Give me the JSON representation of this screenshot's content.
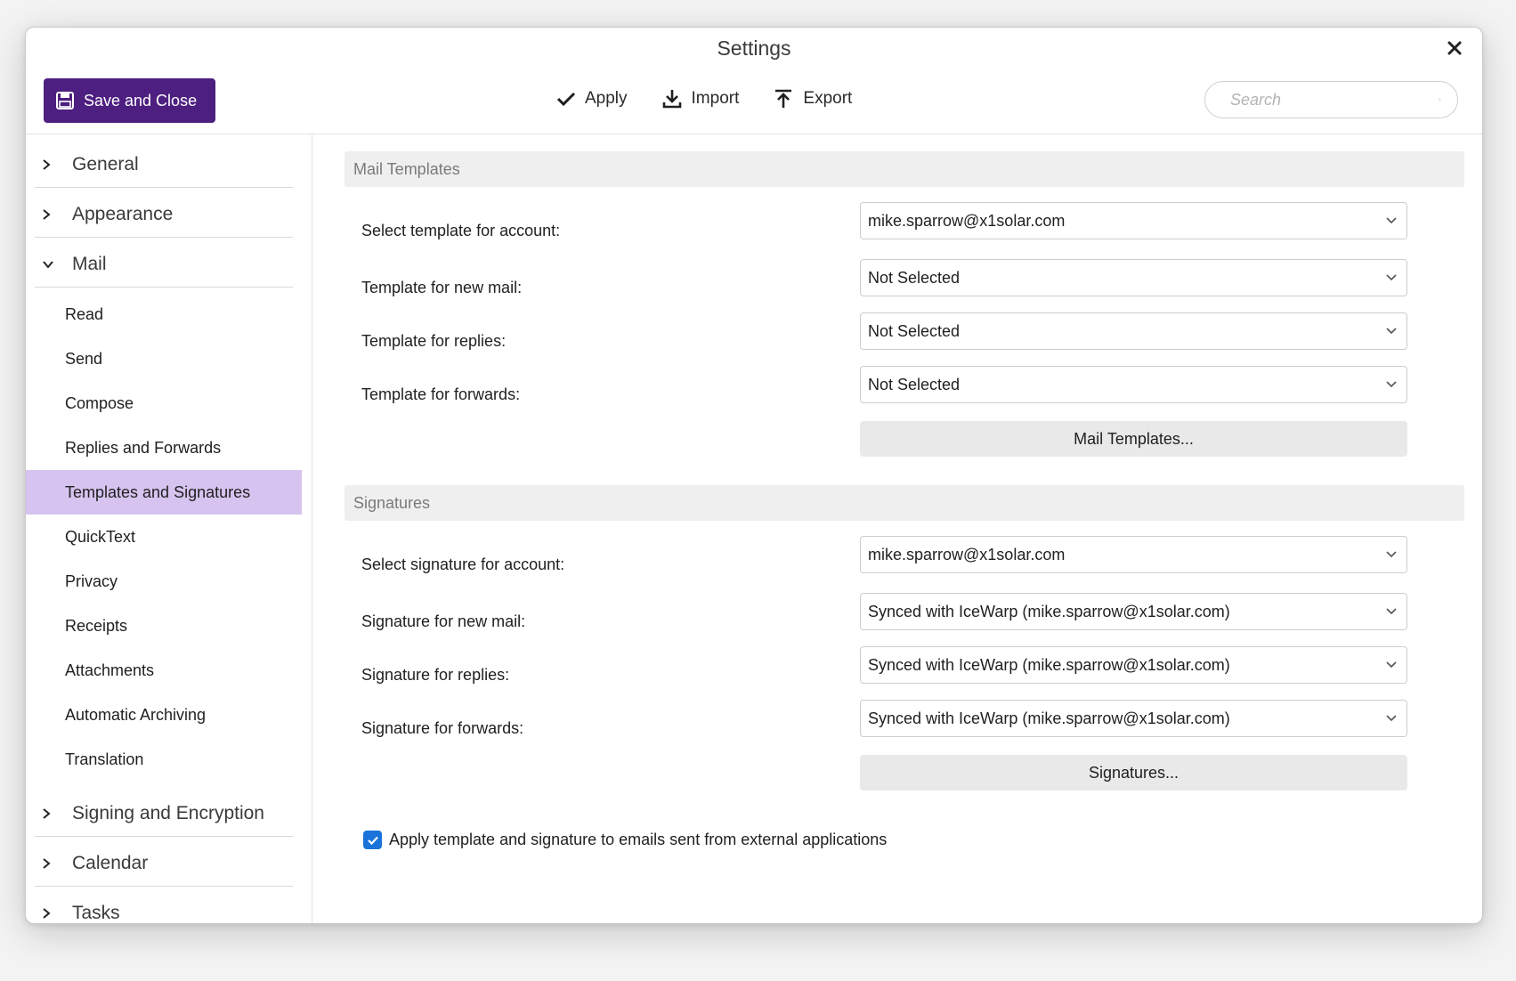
{
  "window": {
    "title": "Settings"
  },
  "header": {
    "save_label": "Save and Close",
    "apply_label": "Apply",
    "import_label": "Import",
    "export_label": "Export",
    "search_placeholder": "Search"
  },
  "sidebar": {
    "sections": [
      {
        "label": "General",
        "expanded": false
      },
      {
        "label": "Appearance",
        "expanded": false
      },
      {
        "label": "Mail",
        "expanded": true
      },
      {
        "label": "Signing and Encryption",
        "expanded": false
      },
      {
        "label": "Calendar",
        "expanded": false
      },
      {
        "label": "Tasks",
        "expanded": false
      }
    ],
    "mail_items": [
      "Read",
      "Send",
      "Compose",
      "Replies and Forwards",
      "Templates and Signatures",
      "QuickText",
      "Privacy",
      "Receipts",
      "Attachments",
      "Automatic Archiving",
      "Translation"
    ],
    "active_item": "Templates and Signatures"
  },
  "templates": {
    "heading": "Mail Templates",
    "account_label": "Select template for account:",
    "account_value": "mike.sparrow@x1solar.com",
    "new_label": "Template for new mail:",
    "new_value": "Not Selected",
    "replies_label": "Template for replies:",
    "replies_value": "Not Selected",
    "forwards_label": "Template for forwards:",
    "forwards_value": "Not Selected",
    "button": "Mail Templates..."
  },
  "signatures": {
    "heading": "Signatures",
    "account_label": "Select signature for account:",
    "account_value": "mike.sparrow@x1solar.com",
    "new_label": "Signature for new mail:",
    "new_value": "Synced with IceWarp (mike.sparrow@x1solar.com)",
    "replies_label": "Signature for replies:",
    "replies_value": "Synced with IceWarp (mike.sparrow@x1solar.com)",
    "forwards_label": "Signature for forwards:",
    "forwards_value": "Synced with IceWarp (mike.sparrow@x1solar.com)",
    "button": "Signatures..."
  },
  "external_apps": {
    "label": "Apply template and signature to emails sent from external applications",
    "checked": true
  },
  "colors": {
    "accent": "#4d1f80",
    "active_item_bg": "#d6c3ef",
    "checkbox": "#1a73d9"
  }
}
